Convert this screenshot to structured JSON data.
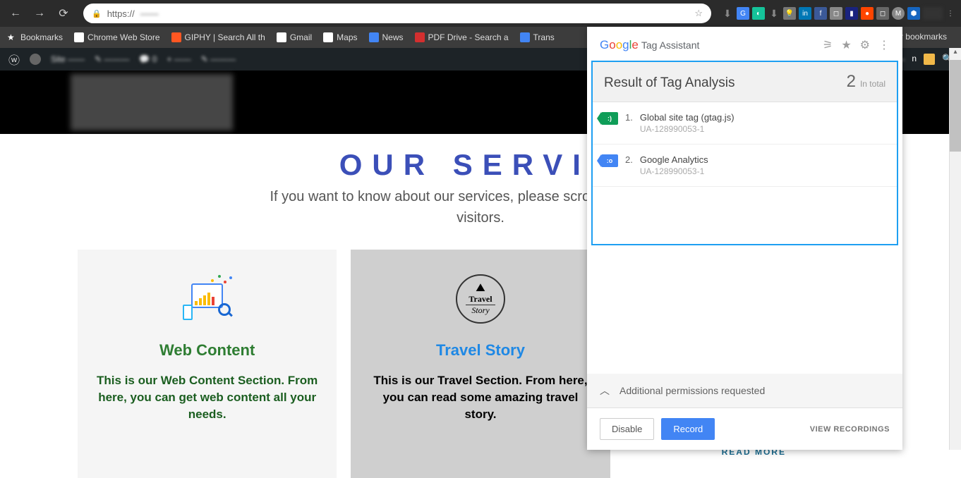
{
  "browser": {
    "url_prefix": "https://",
    "url_blur": "------"
  },
  "bookmarks": {
    "items": [
      {
        "label": "Bookmarks"
      },
      {
        "label": "Chrome Web Store"
      },
      {
        "label": "GIPHY | Search All th"
      },
      {
        "label": "Gmail"
      },
      {
        "label": "Maps"
      },
      {
        "label": "News"
      },
      {
        "label": "PDF Drive - Search a"
      },
      {
        "label": "Trans"
      }
    ],
    "other": "er bookmarks"
  },
  "page": {
    "heading": "OUR SERVIC",
    "sub1": "If you want to know about our services, please scroll below and see",
    "sub2": "visitors.",
    "cards": {
      "web": {
        "title": "Web Content",
        "desc": "This is our Web Content Section. From here, you can get web content all your needs."
      },
      "travel": {
        "title": "Travel Story",
        "logo_l1": "Travel",
        "logo_l2": "Story",
        "desc": "This is our Travel Section. From here, you can read some amazing travel story."
      },
      "third": {
        "read_more": "READ MORE"
      }
    }
  },
  "tag_assistant": {
    "brand": "Google",
    "title": "Tag Assistant",
    "result_title": "Result of Tag Analysis",
    "count": "2",
    "count_label": "In total",
    "items": [
      {
        "num": "1.",
        "name": "Global site tag (gtag.js)",
        "id": "UA-128990053-1",
        "color": "green",
        "glyph": ":)"
      },
      {
        "num": "2.",
        "name": "Google Analytics",
        "id": "UA-128990053-1",
        "color": "blue",
        "glyph": ":o"
      }
    ],
    "perm": "Additional permissions requested",
    "disable": "Disable",
    "record": "Record",
    "view_rec": "VIEW RECORDINGS"
  }
}
